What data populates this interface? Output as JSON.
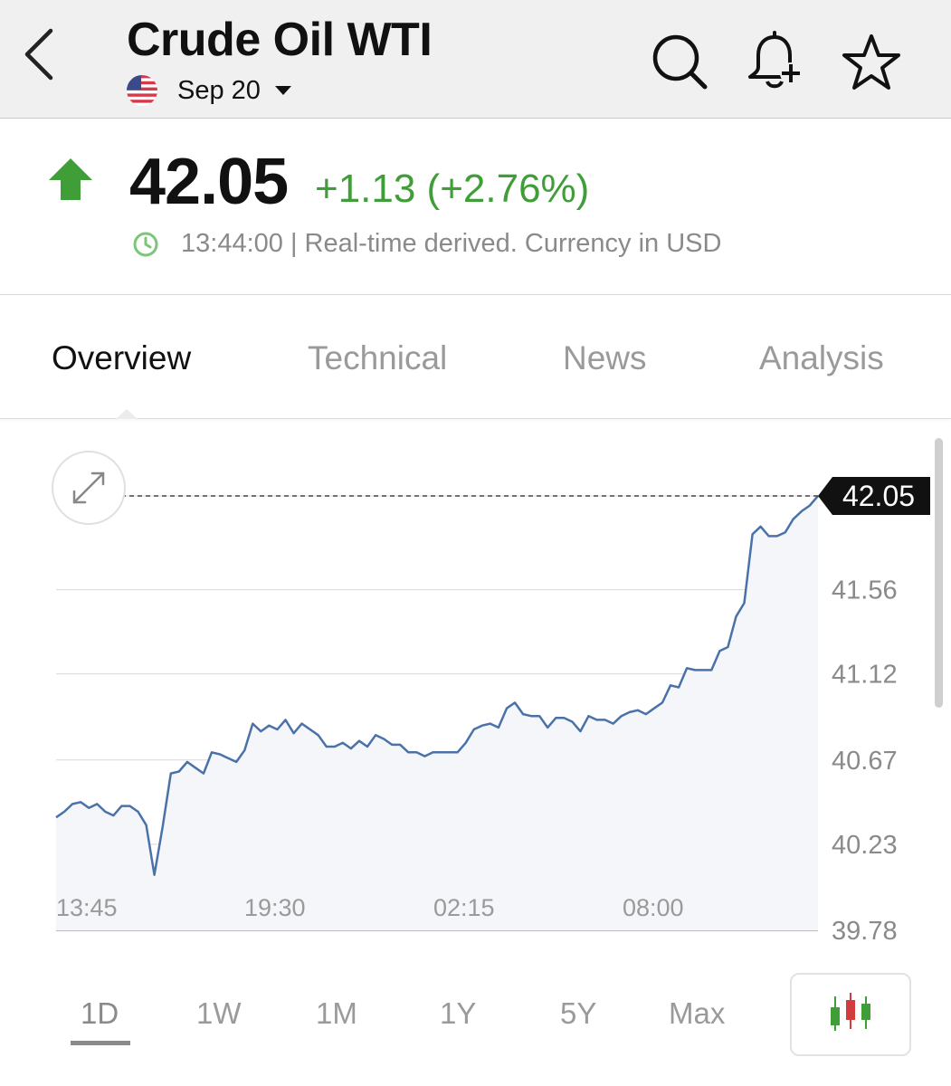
{
  "header": {
    "title": "Crude Oil WTI",
    "expiry": "Sep 20",
    "icons": [
      "back-chevron-icon",
      "search-icon",
      "add-alert-bell-icon",
      "watchlist-star-icon"
    ]
  },
  "quote": {
    "price": "42.05",
    "change": "+1.13 (+2.76%)",
    "time": "13:44:00 | Real-time derived. Currency in USD",
    "up_color": "#3f9e37"
  },
  "tabs": [
    "Overview",
    "Technical",
    "News",
    "Analysis"
  ],
  "chart": {
    "current_label": "42.05",
    "expand_icon": "expand-arrows-icon",
    "line_color": "#4a72a8"
  },
  "chart_data": {
    "type": "area",
    "xlabel": "",
    "ylabel": "",
    "x_ticks": [
      "13:45",
      "19:30",
      "02:15",
      "08:00"
    ],
    "y_ticks": [
      "39.78",
      "40.23",
      "40.67",
      "41.12",
      "41.56"
    ],
    "ylim": [
      39.78,
      42.05
    ],
    "last_value": 42.05,
    "grid": true,
    "series": [
      {
        "values": [
          40.37,
          40.4,
          40.44,
          40.45,
          40.42,
          40.44,
          40.4,
          40.38,
          40.43,
          40.43,
          40.4,
          40.33,
          40.07,
          40.32,
          40.6,
          40.61,
          40.66,
          40.63,
          40.6,
          40.71,
          40.7,
          40.68,
          40.66,
          40.72,
          40.86,
          40.82,
          40.85,
          40.83,
          40.88,
          40.81,
          40.86,
          40.83,
          40.8,
          40.74,
          40.74,
          40.76,
          40.73,
          40.77,
          40.74,
          40.8,
          40.78,
          40.75,
          40.75,
          40.71,
          40.71,
          40.69,
          40.71,
          40.71,
          40.71,
          40.71,
          40.76,
          40.83,
          40.85,
          40.86,
          40.84,
          40.94,
          40.97,
          40.91,
          40.9,
          40.9,
          40.84,
          40.89,
          40.89,
          40.87,
          40.82,
          40.9,
          40.88,
          40.88,
          40.86,
          40.9,
          40.92,
          40.93,
          40.91,
          40.94,
          40.97,
          41.06,
          41.05,
          41.15,
          41.14,
          41.14,
          41.14,
          41.24,
          41.26,
          41.42,
          41.49,
          41.85,
          41.89,
          41.84,
          41.84,
          41.86,
          41.93,
          41.97,
          42.0,
          42.05
        ]
      }
    ]
  },
  "ranges": [
    "1D",
    "1W",
    "1M",
    "1Y",
    "5Y",
    "Max"
  ],
  "active_range": "1D",
  "chart_type_icon": "candlestick-chart-icon"
}
